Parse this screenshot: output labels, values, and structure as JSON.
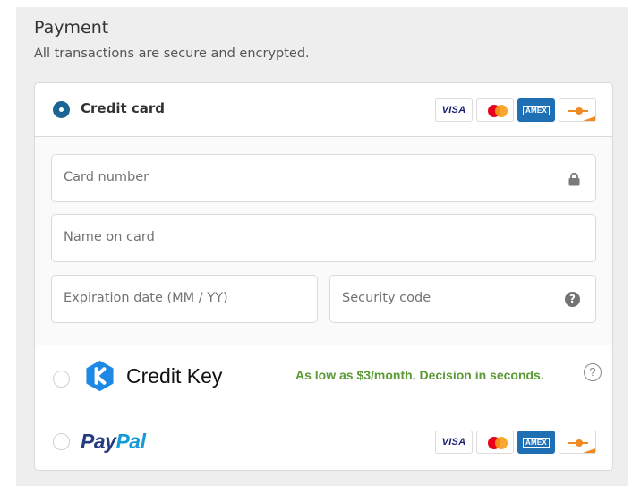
{
  "header": {
    "title": "Payment",
    "subtitle": "All transactions are secure and encrypted."
  },
  "credit_card": {
    "label": "Credit card",
    "selected": true,
    "cards": [
      {
        "name": "visa",
        "text": "VISA"
      },
      {
        "name": "mastercard",
        "text": ""
      },
      {
        "name": "amex",
        "text": "AMEX"
      },
      {
        "name": "discover",
        "text": ""
      }
    ],
    "fields": {
      "card_number_placeholder": "Card number",
      "name_placeholder": "Name on card",
      "expiration_placeholder": "Expiration date (MM / YY)",
      "security_placeholder": "Security code"
    },
    "icons": {
      "lock": "lock-icon",
      "help": "question-circle-icon"
    }
  },
  "credit_key": {
    "label": "Credit Key",
    "promo": "As low as $3/month. Decision in seconds.",
    "help": "?",
    "selected": false
  },
  "paypal": {
    "label_pay": "Pay",
    "label_pal": "Pal",
    "selected": false
  },
  "colors": {
    "accent": "#1b6594",
    "promo_green": "#5b9a36",
    "creditkey_blue": "#1e88e5",
    "paypal_dark": "#253b80",
    "paypal_light": "#179bd7"
  }
}
